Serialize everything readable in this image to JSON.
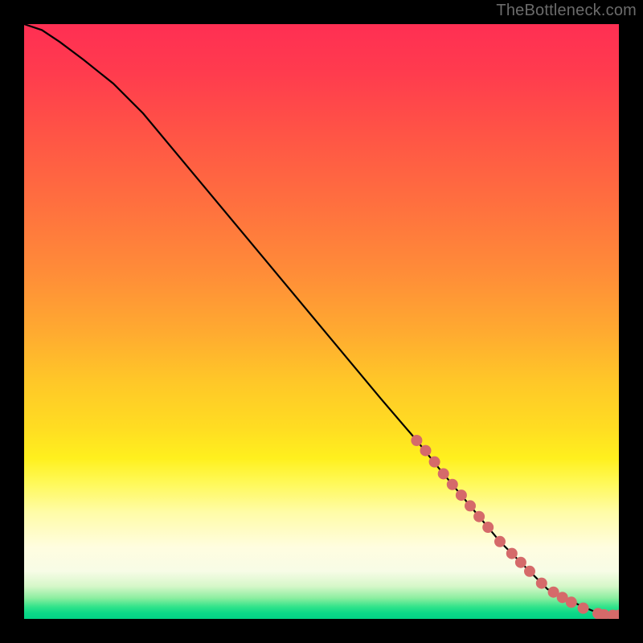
{
  "watermark": "TheBottleneck.com",
  "chart_data": {
    "type": "line",
    "title": "",
    "xlabel": "",
    "ylabel": "",
    "xlim": [
      0,
      100
    ],
    "ylim": [
      0,
      100
    ],
    "grid": false,
    "series": [
      {
        "name": "bottleneck-curve",
        "x": [
          0,
          3,
          6,
          10,
          15,
          20,
          30,
          40,
          50,
          60,
          66,
          70,
          75,
          80,
          83,
          86,
          88,
          90,
          92,
          94,
          96,
          97,
          98,
          100
        ],
        "y": [
          100,
          99,
          97,
          94,
          90,
          85,
          73,
          61,
          49,
          37,
          30,
          25,
          19,
          13,
          10,
          7,
          5,
          4,
          3,
          2,
          1.2,
          0.8,
          0.6,
          0.6
        ]
      }
    ],
    "markers": [
      {
        "x": 66.0,
        "y": 30.0
      },
      {
        "x": 67.5,
        "y": 28.3
      },
      {
        "x": 69.0,
        "y": 26.4
      },
      {
        "x": 70.5,
        "y": 24.4
      },
      {
        "x": 72.0,
        "y": 22.6
      },
      {
        "x": 73.5,
        "y": 20.8
      },
      {
        "x": 75.0,
        "y": 19.0
      },
      {
        "x": 76.5,
        "y": 17.2
      },
      {
        "x": 78.0,
        "y": 15.4
      },
      {
        "x": 80.0,
        "y": 13.0
      },
      {
        "x": 82.0,
        "y": 11.0
      },
      {
        "x": 83.5,
        "y": 9.5
      },
      {
        "x": 85.0,
        "y": 8.0
      },
      {
        "x": 87.0,
        "y": 6.0
      },
      {
        "x": 89.0,
        "y": 4.5
      },
      {
        "x": 90.5,
        "y": 3.6
      },
      {
        "x": 92.0,
        "y": 2.8
      },
      {
        "x": 94.0,
        "y": 1.8
      },
      {
        "x": 96.5,
        "y": 0.9
      },
      {
        "x": 97.5,
        "y": 0.7
      },
      {
        "x": 99.0,
        "y": 0.6
      },
      {
        "x": 100.0,
        "y": 0.6
      }
    ],
    "marker_radius": 7,
    "marker_color": "#d56a6a"
  }
}
